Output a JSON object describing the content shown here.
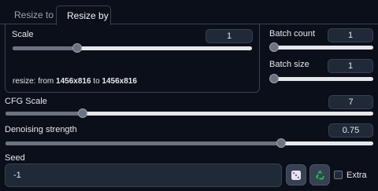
{
  "tabs": [
    {
      "label": "Resize to",
      "active": false
    },
    {
      "label": "Resize by",
      "active": true
    }
  ],
  "scale": {
    "label": "Scale",
    "value": "1",
    "slider_fraction": 0.27
  },
  "batch_count": {
    "label": "Batch count",
    "value": "1",
    "slider_fraction": 0.0
  },
  "batch_size": {
    "label": "Batch size",
    "value": "1",
    "slider_fraction": 0.0
  },
  "resize_info": {
    "prefix": "resize: from ",
    "from": "1456x816",
    "middle": " to ",
    "to": "1456x816"
  },
  "cfg_scale": {
    "label": "CFG Scale",
    "value": "7",
    "slider_fraction": 0.21
  },
  "denoising": {
    "label": "Denoising strength",
    "value": "0.75",
    "slider_fraction": 0.75
  },
  "seed": {
    "label": "Seed",
    "value": "-1"
  },
  "extra": {
    "label": "Extra",
    "checked": false
  },
  "icons": {
    "random_seed": "dice-icon",
    "reuse_seed": "recycle-icon"
  },
  "colors": {
    "background": "#0b0f19",
    "slider_fill": "#6b7280",
    "slider_track": "#e5e7eb",
    "reuse_icon": "#22c55e"
  }
}
